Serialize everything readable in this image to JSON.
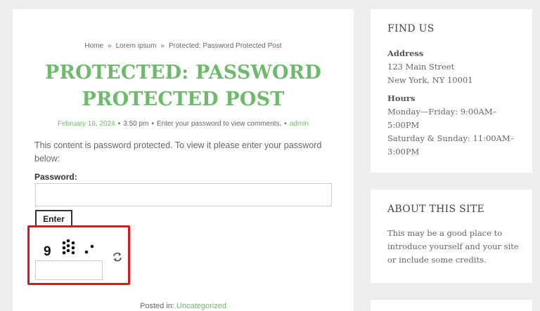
{
  "breadcrumb": {
    "home": "Home",
    "sep": "»",
    "category": "Lorem ipsum",
    "current": "Protected: Password Protected Post"
  },
  "post": {
    "title_line1": "PROTECTED: PASSWORD",
    "title_line2": "PROTECTED POST",
    "date": "February 16, 2024",
    "time": "3:50 pm",
    "comments": "Enter your password to view comments.",
    "author": "admin",
    "meta_sep": "•",
    "content": "This content is password protected. To view it please enter your password below:",
    "password_label": "Password:",
    "enter_label": "Enter",
    "posted_in_label": "Posted in:",
    "posted_in_category": "Uncategorized"
  },
  "captcha": {
    "first_char": "9"
  },
  "sidebar": {
    "find_us": {
      "title": "FIND US",
      "address_label": "Address",
      "address_line1": "123 Main Street",
      "address_line2": "New York, NY 10001",
      "hours_label": "Hours",
      "hours_line1": "Monday—Friday: 9:00AM–",
      "hours_line2": "5:00PM",
      "hours_line3": "Saturday & Sunday: 11:00AM–",
      "hours_line4": "3:00PM"
    },
    "about": {
      "title": "ABOUT THIS SITE",
      "line1": "This may be a good place to",
      "line2": "introduce yourself and your site",
      "line3": "or include some credits."
    }
  },
  "colors": {
    "accent": "#6dbb6a",
    "highlight": "#e0141e"
  }
}
